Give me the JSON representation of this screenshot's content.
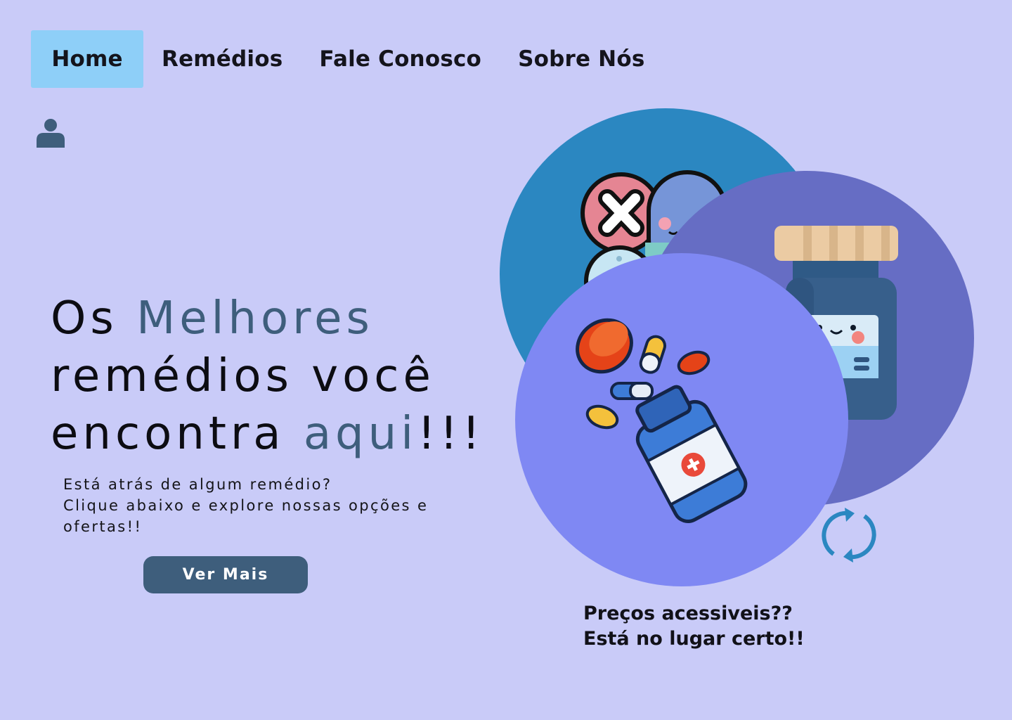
{
  "nav": {
    "items": [
      {
        "label": "Home",
        "active": true
      },
      {
        "label": "Remédios",
        "active": false
      },
      {
        "label": "Fale Conosco",
        "active": false
      },
      {
        "label": "Sobre Nós",
        "active": false
      }
    ]
  },
  "icons": {
    "user": "user-icon",
    "refresh": "refresh-icon"
  },
  "hero": {
    "title_part1": "Os ",
    "title_accent1": "Melhores",
    "title_part2": "remédios você",
    "title_part3": "encontra ",
    "title_accent2": "aqui",
    "title_end": "!!!",
    "subtitle_line1": "Está atrás de algum remédio?",
    "subtitle_line2": "Clique abaixo e explore nossas opções e",
    "subtitle_line3": "ofertas!!",
    "cta_label": "Ver Mais"
  },
  "promo": {
    "line1": "Preços acessiveis??",
    "line2": "Está no lugar certo!!"
  },
  "colors": {
    "background": "#C9CBF8",
    "nav_active": "#8ECFF8",
    "accent": "#3E5E7C",
    "circle_blue": "#2B87C1",
    "circle_indigo": "#666DC4",
    "circle_periwinkle": "#7F88F3"
  }
}
